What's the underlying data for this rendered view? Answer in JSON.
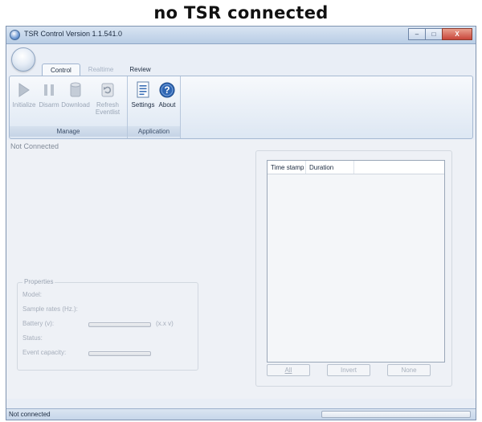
{
  "caption": "no TSR connected",
  "window": {
    "title": "TSR Control Version 1.1.541.0",
    "controls": {
      "minimize": "–",
      "maximize": "□",
      "close": "X"
    }
  },
  "tabs": [
    {
      "label": "Control",
      "state": "active"
    },
    {
      "label": "Realtime",
      "state": "disabled"
    },
    {
      "label": "Review",
      "state": "normal"
    }
  ],
  "ribbon": {
    "manage": {
      "label": "Manage",
      "buttons": [
        {
          "label": "Initialize",
          "icon": "play-icon"
        },
        {
          "label": "Disarm",
          "icon": "pause-icon"
        },
        {
          "label": "Download",
          "icon": "cylinder-icon"
        },
        {
          "label": "Refresh Eventlist",
          "icon": "refresh-icon"
        }
      ]
    },
    "application": {
      "label": "Application",
      "buttons": [
        {
          "label": "Settings",
          "icon": "settings-document-icon"
        },
        {
          "label": "About",
          "icon": "help-icon"
        }
      ]
    }
  },
  "main": {
    "status_title": "Not Connected",
    "properties": {
      "title": "Properties",
      "model_label": "Model:",
      "sample_rates_label": "Sample rates (Hz.):",
      "battery_label": "Battery (v):",
      "battery_value": "(x.x v)",
      "status_label": "Status:",
      "event_capacity_label": "Event capacity:"
    },
    "event_list": {
      "columns": [
        "Time stamp",
        "Duration"
      ],
      "rows": []
    },
    "selection_buttons": {
      "all": "All",
      "invert": "Invert",
      "none": "None"
    }
  },
  "statusbar": {
    "text": "Not connected"
  },
  "colors": {
    "accent": "#3b6fb6",
    "window_bg": "#e9eef6",
    "panel_bg": "#eef1f6"
  }
}
